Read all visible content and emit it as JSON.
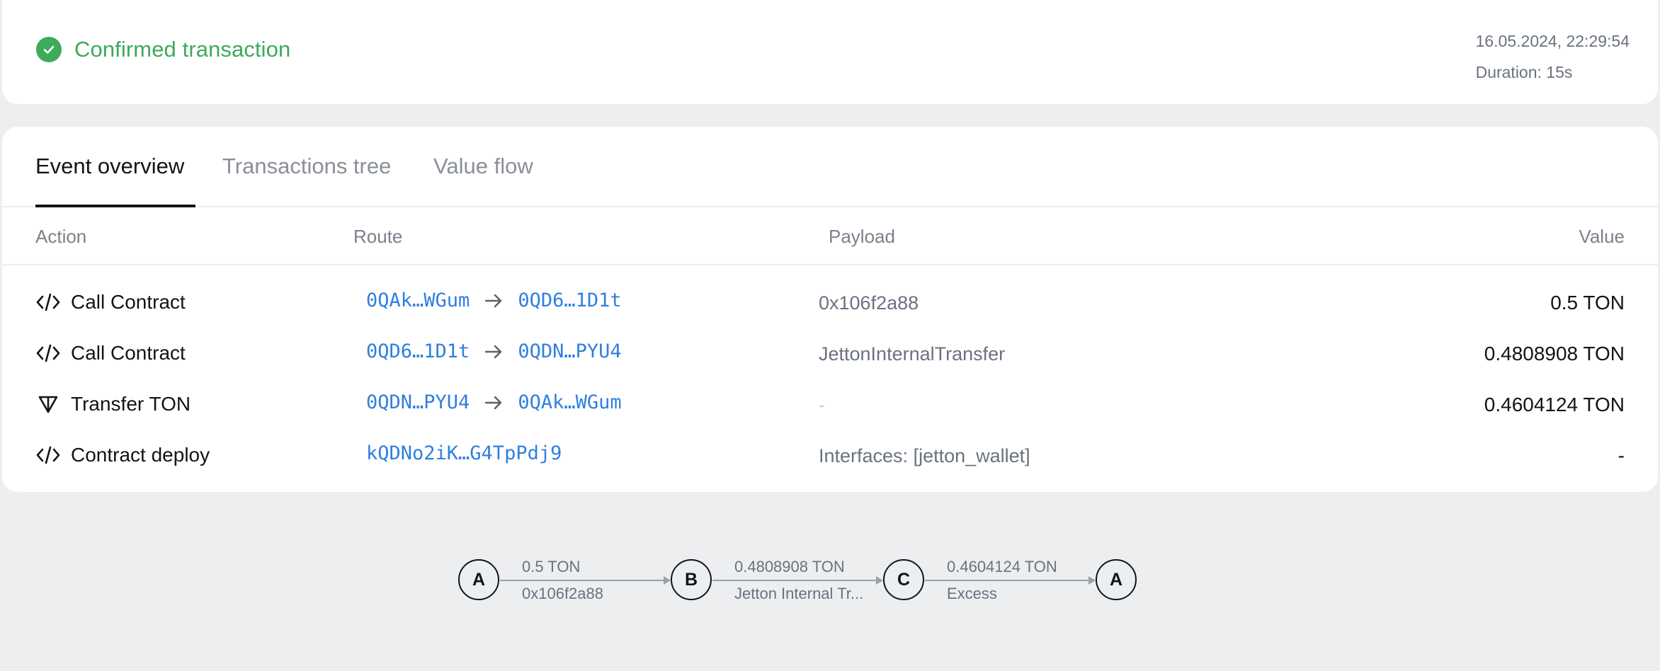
{
  "status": {
    "label": "Confirmed transaction",
    "datetime": "16.05.2024, 22:29:54",
    "duration": "Duration: 15s",
    "accent_color": "#3eaa5b"
  },
  "tabs": [
    {
      "label": "Event overview",
      "active": true
    },
    {
      "label": "Transactions tree",
      "active": false
    },
    {
      "label": "Value flow",
      "active": false
    }
  ],
  "table": {
    "headers": {
      "action": "Action",
      "route": "Route",
      "payload": "Payload",
      "value": "Value"
    },
    "rows": [
      {
        "icon": "code-icon",
        "action": "Call Contract",
        "from": "0QAk…WGum",
        "to": "0QD6…1D1t",
        "payload": "0x106f2a88",
        "value": "0.5 TON"
      },
      {
        "icon": "code-icon",
        "action": "Call Contract",
        "from": "0QD6…1D1t",
        "to": "0QDN…PYU4",
        "payload": "JettonInternalTransfer",
        "value": "0.4808908 TON"
      },
      {
        "icon": "ton-icon",
        "action": "Transfer TON",
        "from": "0QDN…PYU4",
        "to": "0QAk…WGum",
        "payload": "-",
        "value": "0.4604124 TON"
      },
      {
        "icon": "code-icon",
        "action": "Contract deploy",
        "from": "kQDNo2iK…G4TpPdj9",
        "to": "",
        "payload": "Interfaces: [jetton_wallet]",
        "value": "-"
      }
    ]
  },
  "flow": {
    "nodes": [
      "A",
      "B",
      "C",
      "A"
    ],
    "edges": [
      {
        "amount": "0.5 TON",
        "label": "0x106f2a88"
      },
      {
        "amount": "0.4808908 TON",
        "label": "Jetton Internal Tr..."
      },
      {
        "amount": "0.4604124 TON",
        "label": "Excess"
      }
    ]
  }
}
